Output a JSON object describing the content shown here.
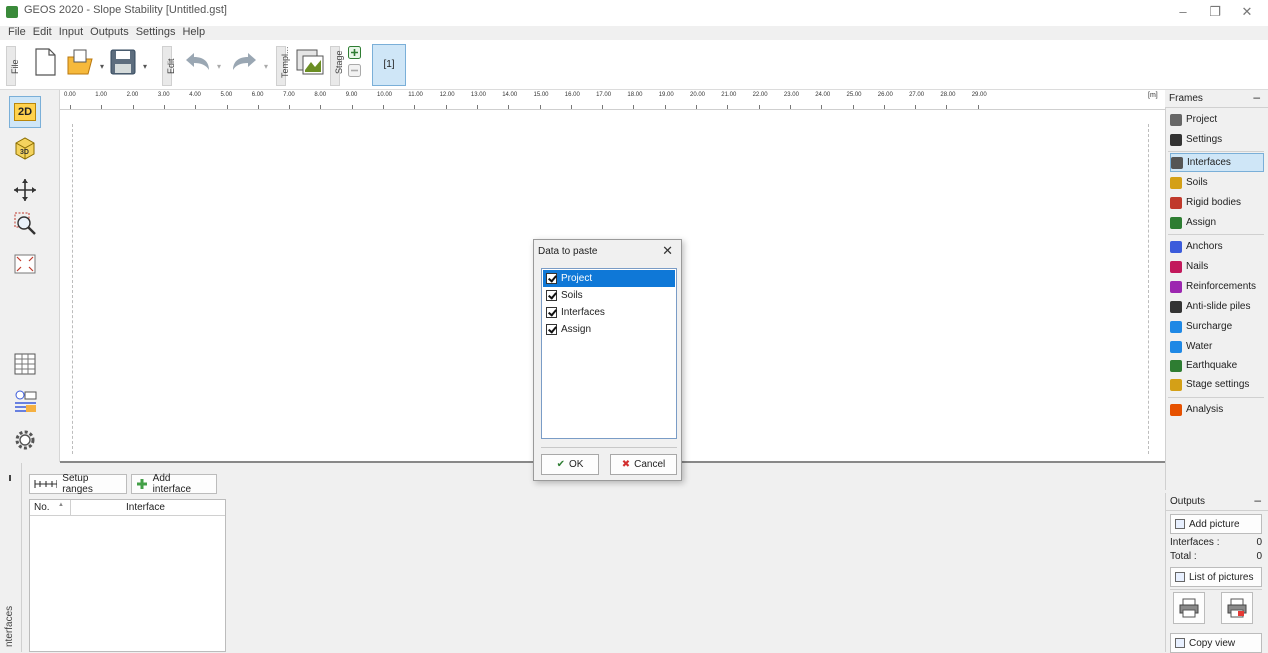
{
  "window": {
    "title": "GEOS 2020 - Slope Stability [Untitled.gst]",
    "controls": {
      "minimize": "–",
      "maximize": "❐",
      "close": "✕"
    }
  },
  "menu": [
    "File",
    "Edit",
    "Input",
    "Outputs",
    "Settings",
    "Help"
  ],
  "toolbar": {
    "file_label": "File",
    "edit_label": "Edit",
    "templates_label": "Templ...",
    "stage_label": "Stage",
    "stage_button": "[1]"
  },
  "left_tools": {
    "view_2d": "2D",
    "view_3d": "3D"
  },
  "ruler": {
    "ticks": [
      "0.00",
      "1.00",
      "2.00",
      "3.00",
      "4.00",
      "5.00",
      "6.00",
      "7.00",
      "8.00",
      "9.00",
      "10.00",
      "11.00",
      "12.00",
      "13.00",
      "14.00",
      "15.00",
      "16.00",
      "17.00",
      "18.00",
      "19.00",
      "20.00",
      "21.00",
      "22.00",
      "23.00",
      "24.00",
      "25.00",
      "26.00",
      "27.00",
      "28.00",
      "29.00"
    ],
    "unit": "[m]"
  },
  "frames": {
    "title": "Frames",
    "collapse": "–",
    "items": [
      {
        "label": "Project",
        "icon": "project-icon",
        "color": "#666666"
      },
      {
        "label": "Settings",
        "icon": "gear-icon",
        "color": "#333333"
      },
      {
        "label": "Interfaces",
        "icon": "interfaces-icon",
        "color": "#555555",
        "selected": true
      },
      {
        "label": "Soils",
        "icon": "soils-icon",
        "color": "#d4a017"
      },
      {
        "label": "Rigid bodies",
        "icon": "rigid-bodies-icon",
        "color": "#c0392b"
      },
      {
        "label": "Assign",
        "icon": "assign-icon",
        "color": "#2e7d32"
      },
      {
        "label": "Anchors",
        "icon": "anchors-icon",
        "color": "#3b5bdb"
      },
      {
        "label": "Nails",
        "icon": "nails-icon",
        "color": "#c2185b"
      },
      {
        "label": "Reinforcements",
        "icon": "reinforcements-icon",
        "color": "#9c27b0"
      },
      {
        "label": "Anti-slide piles",
        "icon": "anti-slide-piles-icon",
        "color": "#333333"
      },
      {
        "label": "Surcharge",
        "icon": "surcharge-icon",
        "color": "#1e88e5"
      },
      {
        "label": "Water",
        "icon": "water-icon",
        "color": "#1e88e5"
      },
      {
        "label": "Earthquake",
        "icon": "earthquake-icon",
        "color": "#2e7d32"
      },
      {
        "label": "Stage settings",
        "icon": "stage-settings-icon",
        "color": "#d4a017"
      },
      {
        "label": "Analysis",
        "icon": "analysis-icon",
        "color": "#e65100"
      }
    ]
  },
  "outputs": {
    "title": "Outputs",
    "collapse": "–",
    "add_picture": "Add picture",
    "interfaces_label": "Interfaces :",
    "interfaces_value": "0",
    "total_label": "Total :",
    "total_value": "0",
    "list_of_pictures": "List of pictures",
    "copy_view": "Copy view"
  },
  "bottom": {
    "tab_label": "nterfaces",
    "setup_ranges": "Setup ranges",
    "add_interface": "Add interface",
    "table": {
      "columns": [
        "No.",
        "Interface"
      ],
      "sort_indicator": "▲",
      "rows": []
    }
  },
  "dialog": {
    "title": "Data to paste",
    "close": "✕",
    "options": [
      {
        "label": "Project",
        "checked": true,
        "selected": true
      },
      {
        "label": "Soils",
        "checked": true
      },
      {
        "label": "Interfaces",
        "checked": true
      },
      {
        "label": "Assign",
        "checked": true
      }
    ],
    "ok": "OK",
    "cancel": "Cancel"
  }
}
